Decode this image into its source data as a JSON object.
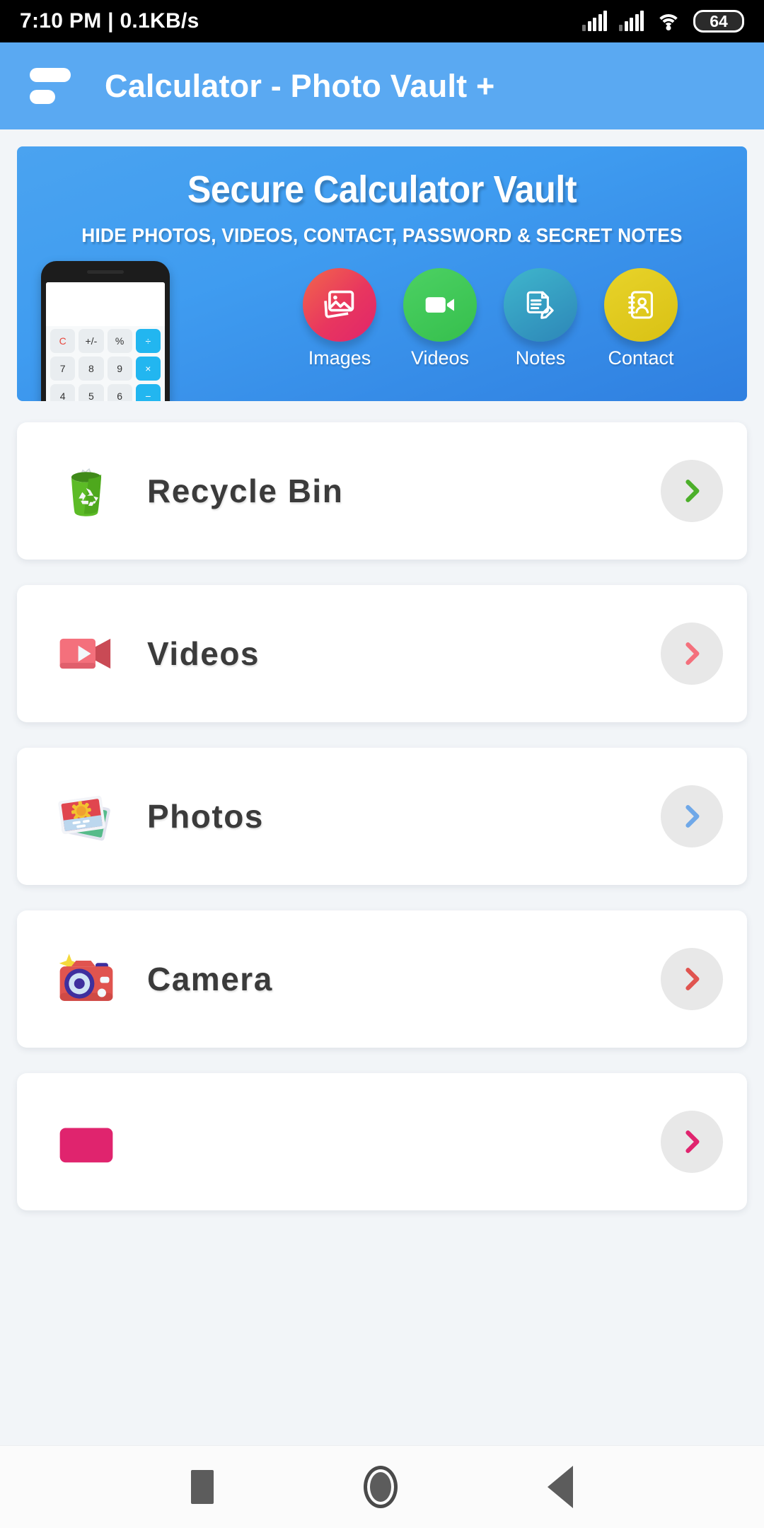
{
  "statusbar": {
    "time_and_speed": "7:10 PM | 0.1KB/s",
    "battery": "64",
    "icons": [
      "signal-bars-icon",
      "signal-bars-icon",
      "wifi-icon",
      "battery-icon"
    ]
  },
  "appbar": {
    "menu_icon": "hamburger-menu-icon",
    "title": "Calculator - Photo Vault +",
    "background": "#5aa9f2"
  },
  "banner": {
    "title": "Secure Calculator Vault",
    "subtitle": "HIDE PHOTOS, VIDEOS, CONTACT, PASSWORD & SECRET NOTES",
    "features": [
      {
        "label": "Images",
        "icon": "image-icon",
        "color": "#e8365f"
      },
      {
        "label": "Videos",
        "icon": "video-camera-icon",
        "color": "#36bf4d"
      },
      {
        "label": "Notes",
        "icon": "note-pencil-icon",
        "color": "#2d86b8"
      },
      {
        "label": "Contact",
        "icon": "contact-book-icon",
        "color": "#d9c114"
      }
    ],
    "calculator_keys": [
      "C",
      "+/-",
      "%",
      "÷",
      "7",
      "8",
      "9",
      "×",
      "4",
      "5",
      "6",
      "−"
    ]
  },
  "list": {
    "items": [
      {
        "label": "Recycle Bin",
        "icon": "recycle-bin-icon",
        "accent": "#4caf2a",
        "chevron": "chevron-right-icon"
      },
      {
        "label": "Videos",
        "icon": "video-camera-icon",
        "accent": "#f4707c",
        "chevron": "chevron-right-icon"
      },
      {
        "label": "Photos",
        "icon": "photos-stack-icon",
        "accent": "#6fa8e8",
        "chevron": "chevron-right-icon"
      },
      {
        "label": "Camera",
        "icon": "camera-icon",
        "accent": "#e0544f",
        "chevron": "chevron-right-icon"
      },
      {
        "label": "",
        "icon": "pink-icon",
        "accent": "#e0246e",
        "chevron": "chevron-right-icon"
      }
    ]
  },
  "navbar": {
    "recents": "square-recents-icon",
    "home": "circle-home-icon",
    "back": "triangle-back-icon"
  }
}
